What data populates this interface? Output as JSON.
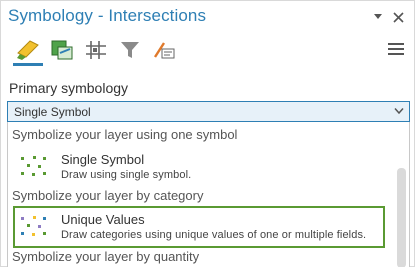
{
  "window": {
    "title": "Symbology - Intersections",
    "menu_icon": "chevron-down-icon",
    "close_icon": "close-icon"
  },
  "tabs": [
    {
      "icon": "primary-symbology-icon",
      "active": true
    },
    {
      "icon": "vary-symbology-icon",
      "active": false
    },
    {
      "icon": "symbol-layer-drawing-icon",
      "active": false
    },
    {
      "icon": "filter-icon",
      "active": false
    },
    {
      "icon": "label-classes-icon",
      "active": false
    }
  ],
  "primary": {
    "label": "Primary symbology",
    "selected": "Single Symbol"
  },
  "list": {
    "groups": [
      {
        "header": "Symbolize your layer using one symbol",
        "items": [
          {
            "name": "Single Symbol",
            "desc": "Draw using single symbol.",
            "icon": "single-symbol-icon",
            "selected": false
          }
        ]
      },
      {
        "header": "Symbolize your layer by category",
        "items": [
          {
            "name": "Unique Values",
            "desc": "Draw categories using unique values of one or multiple fields.",
            "icon": "unique-values-icon",
            "selected": true
          }
        ]
      },
      {
        "header": "Symbolize your layer by quantity",
        "items": []
      }
    ]
  },
  "colors": {
    "accent": "#2e7fb4",
    "selection": "#5a9a32",
    "dropdown_bg": "#e7f1f9"
  }
}
